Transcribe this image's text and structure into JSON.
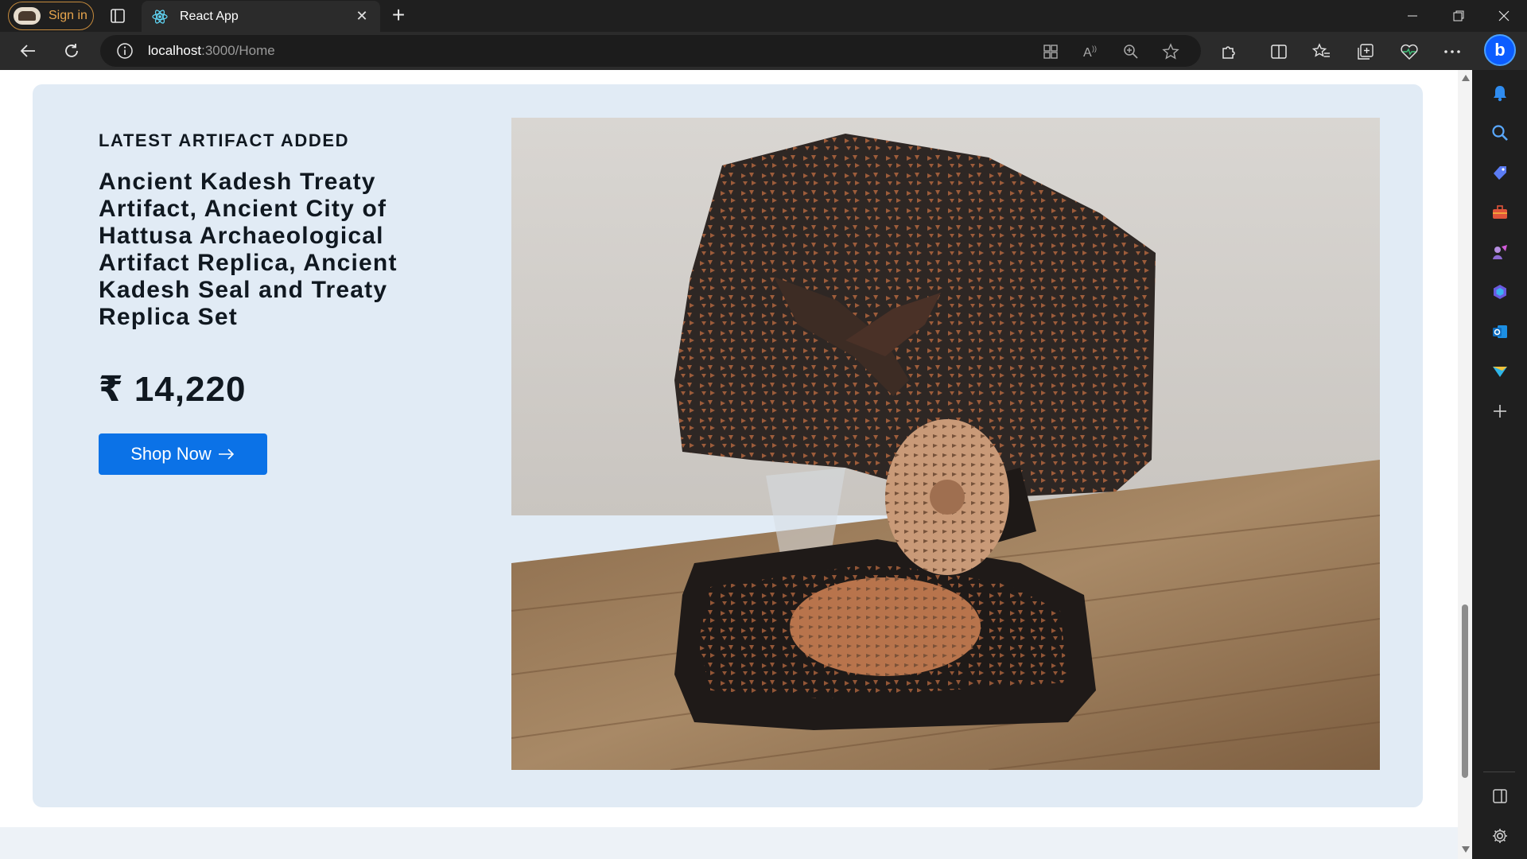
{
  "browser": {
    "signin_label": "Sign in",
    "tab_title": "React App",
    "url_host": "localhost",
    "url_rest": ":3000/Home",
    "accent_profile": "#e8a54d"
  },
  "hero": {
    "eyebrow": "LATEST ARTIFACT ADDED",
    "title": "Ancient Kadesh Treaty Artifact, Ancient City of Hattusa Archaeological Artifact Replica, Ancient Kadesh Seal and Treaty Replica Set",
    "price": "₹ 14,220",
    "cta_label": "Shop Now",
    "cta_color": "#0b72e7",
    "background": "#e1ebf5"
  }
}
